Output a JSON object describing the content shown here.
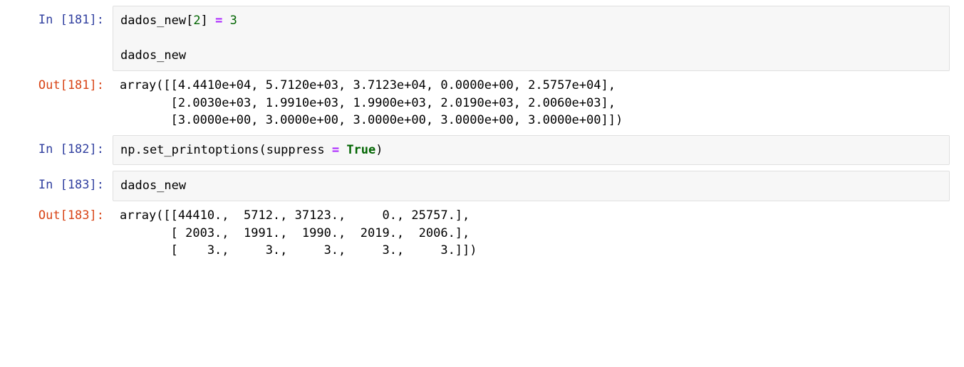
{
  "cells": {
    "c181_in": {
      "prompt": "In [181]:",
      "code": {
        "line1_pre": "dados_new[",
        "line1_idx": "2",
        "line1_mid": "] ",
        "line1_op": "=",
        "line1_rhs": " 3",
        "blank": "",
        "line3": "dados_new"
      }
    },
    "c181_out": {
      "prompt": "Out[181]:",
      "text": "array([[4.4410e+04, 5.7120e+03, 3.7123e+04, 0.0000e+00, 2.5757e+04],\n       [2.0030e+03, 1.9910e+03, 1.9900e+03, 2.0190e+03, 2.0060e+03],\n       [3.0000e+00, 3.0000e+00, 3.0000e+00, 3.0000e+00, 3.0000e+00]])"
    },
    "c182_in": {
      "prompt": "In [182]:",
      "code": {
        "pre": "np.set_printoptions(suppress ",
        "op": "=",
        "mid": " ",
        "kw": "True",
        "post": ")"
      }
    },
    "c183_in": {
      "prompt": "In [183]:",
      "code": {
        "line1": "dados_new"
      }
    },
    "c183_out": {
      "prompt": "Out[183]:",
      "text": "array([[44410.,  5712., 37123.,     0., 25757.],\n       [ 2003.,  1991.,  1990.,  2019.,  2006.],\n       [    3.,     3.,     3.,     3.,     3.]])"
    }
  }
}
